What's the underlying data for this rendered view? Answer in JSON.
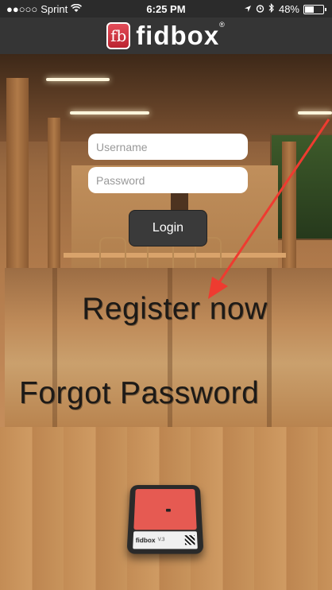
{
  "status_bar": {
    "carrier": "Sprint",
    "time": "6:25 PM",
    "battery": "48%",
    "battery_level": 0.48,
    "icons": [
      "signal-dots-icon",
      "wifi-icon",
      "location-icon",
      "alarm-icon",
      "bluetooth-icon",
      "battery-icon"
    ]
  },
  "header": {
    "logo_mark": "fb",
    "logo_text": "fidbox",
    "logo_reg": "®"
  },
  "login": {
    "username_placeholder": "Username",
    "password_placeholder": "Password",
    "username_value": "",
    "password_value": "",
    "login_label": "Login"
  },
  "links": {
    "register_label": "Register now",
    "forgot_label": "Forgot Password"
  },
  "device": {
    "brand": "fidbox",
    "version": "V.3"
  },
  "colors": {
    "header": "#353535",
    "status_bar": "#2b2b2b",
    "logo_red": "#d2323f",
    "button": "#3a3a3a",
    "arrow": "#ee3b30"
  }
}
